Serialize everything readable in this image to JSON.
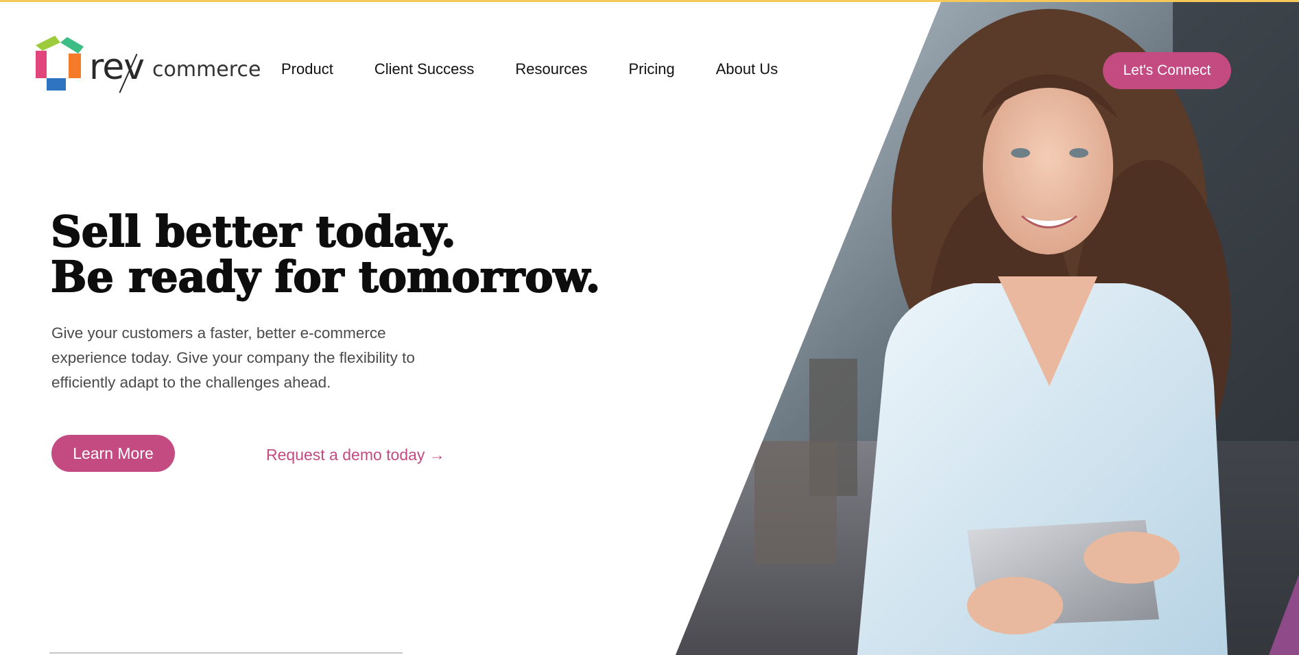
{
  "brand": {
    "logo_rev": "rev",
    "logo_commerce": "commerce",
    "logo_colors": {
      "green": "#9ccc3c",
      "teal": "#3bbd85",
      "pink": "#e0457b",
      "orange": "#f47b2a",
      "blue": "#2f74c0"
    }
  },
  "nav": {
    "links": [
      "Product",
      "Client Success",
      "Resources",
      "Pricing",
      "About Us"
    ],
    "cta_label": "Let's Connect"
  },
  "hero": {
    "headline_line1": "Sell better today.",
    "headline_line2": "Be ready for tomorrow.",
    "intro": "Give your customers a faster, better e-commerce experience today. Give your company the flexibility to efficiently adapt to the challenges ahead.",
    "learn_more_label": "Learn More",
    "demo_link_label": "Request a demo today →"
  },
  "colors": {
    "accent": "#c44b82",
    "top_line": "#f6c85a",
    "text": "#0d0d0d"
  }
}
